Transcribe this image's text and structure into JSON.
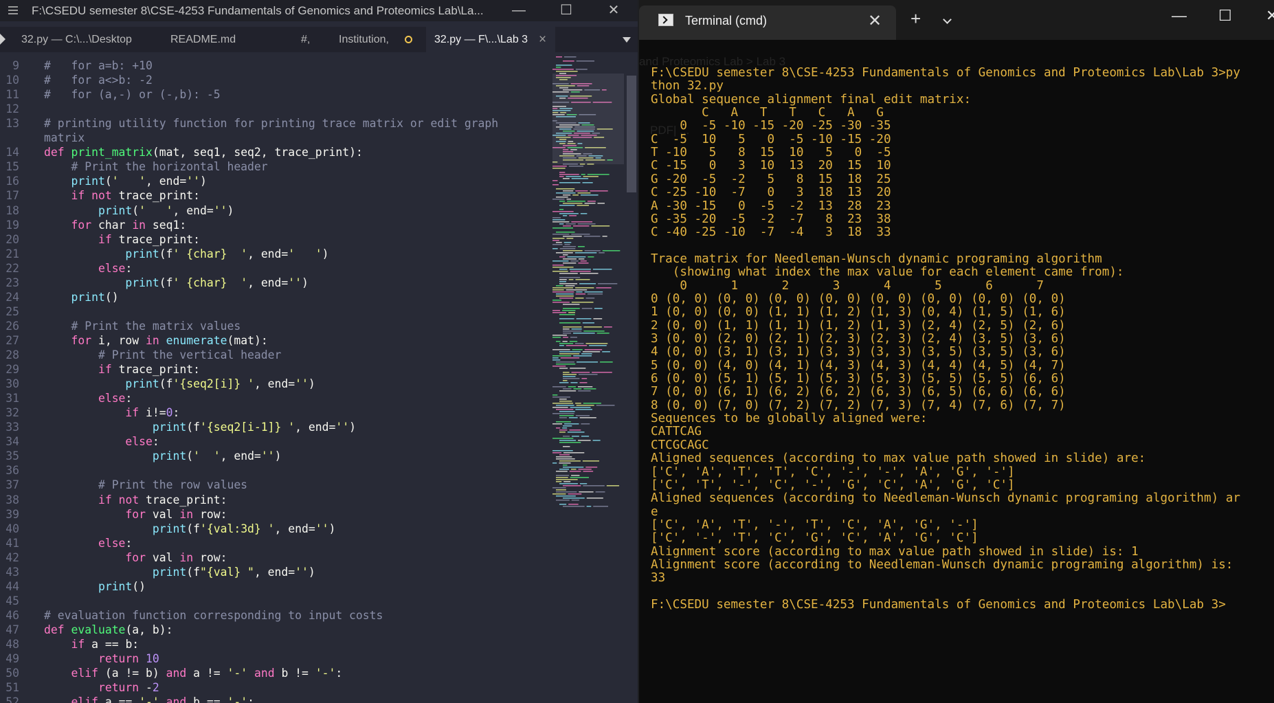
{
  "editor": {
    "title": "F:\\CSEDU semester 8\\CSE-4253 Fundamentals of Genomics and Proteomics Lab\\La...",
    "tabs": [
      {
        "label": "32.py — C:\\...\\Desktop"
      },
      {
        "label": "README.md"
      },
      {
        "label": "#,"
      },
      {
        "label": "Institution,"
      },
      {
        "label": "32.py — F\\...\\Lab 3"
      }
    ],
    "window_buttons": {
      "minimize": "—",
      "maximize": "☐",
      "close": "✕"
    },
    "code_lines": [
      {
        "n": "9",
        "t": "#   for a=b: +10"
      },
      {
        "n": "10",
        "t": "#   for a<>b: -2"
      },
      {
        "n": "11",
        "t": "#   for (a,-) or (-,b): -5"
      },
      {
        "n": "12",
        "t": ""
      },
      {
        "n": "13",
        "t": "# printing utility function for printing trace matrix or edit graph"
      },
      {
        "n": "",
        "t": "matrix"
      },
      {
        "n": "14",
        "t": "def print_matrix(mat, seq1, seq2, trace_print):"
      },
      {
        "n": "15",
        "t": "    # Print the horizontal header"
      },
      {
        "n": "16",
        "t": "    print('   ', end='')"
      },
      {
        "n": "17",
        "t": "    if not trace_print:"
      },
      {
        "n": "18",
        "t": "        print('   ', end='')"
      },
      {
        "n": "19",
        "t": "    for char in seq1:"
      },
      {
        "n": "20",
        "t": "        if trace_print:"
      },
      {
        "n": "21",
        "t": "            print(f' {char}  ', end='   ')"
      },
      {
        "n": "22",
        "t": "        else:"
      },
      {
        "n": "23",
        "t": "            print(f' {char}  ', end='')"
      },
      {
        "n": "24",
        "t": "    print()"
      },
      {
        "n": "25",
        "t": ""
      },
      {
        "n": "26",
        "t": "    # Print the matrix values"
      },
      {
        "n": "27",
        "t": "    for i, row in enumerate(mat):"
      },
      {
        "n": "28",
        "t": "        # Print the vertical header"
      },
      {
        "n": "29",
        "t": "        if trace_print:"
      },
      {
        "n": "30",
        "t": "            print(f'{seq2[i]} ', end='')"
      },
      {
        "n": "31",
        "t": "        else:"
      },
      {
        "n": "32",
        "t": "            if i!=0:"
      },
      {
        "n": "33",
        "t": "                print(f'{seq2[i-1]} ', end='')"
      },
      {
        "n": "34",
        "t": "            else:"
      },
      {
        "n": "35",
        "t": "                print('  ', end='')"
      },
      {
        "n": "36",
        "t": ""
      },
      {
        "n": "37",
        "t": "        # Print the row values"
      },
      {
        "n": "38",
        "t": "        if not trace_print:"
      },
      {
        "n": "39",
        "t": "            for val in row:"
      },
      {
        "n": "40",
        "t": "                print(f'{val:3d} ', end='')"
      },
      {
        "n": "41",
        "t": "        else:"
      },
      {
        "n": "42",
        "t": "            for val in row:"
      },
      {
        "n": "43",
        "t": "                print(f\"{val} \", end='')"
      },
      {
        "n": "44",
        "t": "        print()"
      },
      {
        "n": "45",
        "t": ""
      },
      {
        "n": "46",
        "t": "# evaluation function corresponding to input costs"
      },
      {
        "n": "47",
        "t": "def evaluate(a, b):"
      },
      {
        "n": "48",
        "t": "    if a == b:"
      },
      {
        "n": "49",
        "t": "        return 10"
      },
      {
        "n": "50",
        "t": "    elif (a != b) and a != '-' and b != '-':"
      },
      {
        "n": "51",
        "t": "        return -2"
      },
      {
        "n": "52",
        "t": "    elif a == '-' and b == '-':"
      }
    ],
    "colors": {
      "background": "#282a36",
      "keyword": "#ff79c6",
      "function": "#50fa7b",
      "string": "#f1fa8c",
      "number": "#bd93f9",
      "comment": "#8a8fa8"
    }
  },
  "terminal": {
    "tab_title": "Terminal (cmd)",
    "new_tab_label": "+",
    "background_text": {
      "line1": "and Proteomics Lab  >  Lab 3",
      "line2": "PDF| ..."
    },
    "text_color": "#e3b341",
    "output_lines": [
      "F:\\CSEDU semester 8\\CSE-4253 Fundamentals of Genomics and Proteomics Lab\\Lab 3>py",
      "thon 32.py",
      "Global sequence alignment final edit matrix:",
      "       C   A   T   T   C   A   G",
      "    0  -5 -10 -15 -20 -25 -30 -35",
      "C  -5  10   5   0  -5 -10 -15 -20",
      "T -10   5   8  15  10   5   0  -5",
      "C -15   0   3  10  13  20  15  10",
      "G -20  -5  -2   5   8  15  18  25",
      "C -25 -10  -7   0   3  18  13  20",
      "A -30 -15   0  -5  -2  13  28  23",
      "G -35 -20  -5  -2  -7   8  23  38",
      "C -40 -25 -10  -7  -4   3  18  33",
      "",
      "Trace matrix for Needleman-Wunsch dynamic programing algorithm",
      "   (showing what index the max value for each element came from):",
      "    0      1      2      3      4      5      6      7",
      "0 (0, 0) (0, 0) (0, 0) (0, 0) (0, 0) (0, 0) (0, 0) (0, 0)",
      "1 (0, 0) (0, 0) (1, 1) (1, 2) (1, 3) (0, 4) (1, 5) (1, 6)",
      "2 (0, 0) (1, 1) (1, 1) (1, 2) (1, 3) (2, 4) (2, 5) (2, 6)",
      "3 (0, 0) (2, 0) (2, 1) (2, 3) (2, 3) (2, 4) (3, 5) (3, 6)",
      "4 (0, 0) (3, 1) (3, 1) (3, 3) (3, 3) (3, 5) (3, 5) (3, 6)",
      "5 (0, 0) (4, 0) (4, 1) (4, 3) (4, 3) (4, 4) (4, 5) (4, 7)",
      "6 (0, 0) (5, 1) (5, 1) (5, 3) (5, 3) (5, 5) (5, 5) (6, 6)",
      "7 (0, 0) (6, 1) (6, 2) (6, 2) (6, 3) (6, 5) (6, 6) (6, 6)",
      "8 (0, 0) (7, 0) (7, 2) (7, 2) (7, 3) (7, 4) (7, 6) (7, 7)",
      "Sequences to be globally aligned were:",
      "CATTCAG",
      "CTCGCAGC",
      "Aligned sequences (according to max value path showed in slide) are:",
      "['C', 'A', 'T', 'T', 'C', '-', '-', 'A', 'G', '-']",
      "['C', 'T', '-', 'C', '-', 'G', 'C', 'A', 'G', 'C']",
      "Aligned sequences (according to Needleman-Wunsch dynamic programing algorithm) ar",
      "e",
      "['C', 'A', 'T', '-', 'T', 'C', 'A', 'G', '-']",
      "['C', '-', 'T', 'C', 'G', 'C', 'A', 'G', 'C']",
      "Alignment score (according to max value path showed in slide) is: 1",
      "Alignment score (according to Needleman-Wunsch dynamic programing algorithm) is:",
      "33",
      "",
      "F:\\CSEDU semester 8\\CSE-4253 Fundamentals of Genomics and Proteomics Lab\\Lab 3>"
    ]
  }
}
